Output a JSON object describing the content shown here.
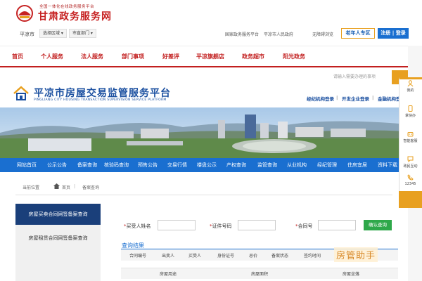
{
  "header": {
    "logo_subtitle": "全国一体化在线政务服务平台",
    "logo_title": "甘肃政务服务网",
    "city": "平凉市",
    "region_select": "选择区域",
    "dept_select": "市直部门",
    "links": [
      "国家政务服务平台",
      "平凉市人民政府",
      "无障碍浏览"
    ],
    "elder_button": "老年人专区",
    "login_button": "注册 | 登录"
  },
  "main_nav": [
    "首页",
    "个人服务",
    "法人服务",
    "部门事项",
    "好差评",
    "平凉旗舰店",
    "政务超市",
    "阳光政务"
  ],
  "subsite": {
    "search_placeholder": "请输入需要办理的事项",
    "title": "平凉市房屋交易监管服务平台",
    "title_en": "PINGLIANG CITY HOUSING TRANSACTION SUPERVISION SERVICE PLATFORM",
    "right_links": [
      "经纪机构登录",
      "开发企业登录",
      "金融机构登"
    ],
    "nav": [
      "网站首页",
      "公示公告",
      "备案查询",
      "核验码查询",
      "预售公告",
      "交易行情",
      "楼盘公示",
      "产权查询",
      "监管查询",
      "从业机构",
      "经纪管理",
      "住房宜居",
      "资料下载"
    ]
  },
  "breadcrumb": {
    "label": "当前位置",
    "home": "首页",
    "current": "备案查询"
  },
  "left_menu": [
    "房屋买卖合同网签备案查询",
    "房屋租赁合同网签备案查询"
  ],
  "form": {
    "fields": [
      {
        "label": "买受人姓名",
        "value": ""
      },
      {
        "label": "证件号码",
        "value": ""
      },
      {
        "label": "合同号",
        "value": ""
      }
    ],
    "query_button": "确认查询"
  },
  "results": {
    "title": "查询结果",
    "columns": [
      "合同编号",
      "出卖人",
      "买受人",
      "身份证号",
      "总价",
      "备案状态",
      "签约时间"
    ],
    "columns2": [
      "房屋用途",
      "房屋面积",
      "房屋坐落"
    ]
  },
  "watermark": "房管助手",
  "sidebar": {
    "items": [
      {
        "icon": "person-icon",
        "label": "我的"
      },
      {
        "icon": "phone-icon",
        "label": "掌快办"
      },
      {
        "icon": "robot-icon",
        "label": "智能客服"
      },
      {
        "icon": "chat-icon",
        "label": "政民互动"
      },
      {
        "icon": "hotline-icon",
        "label": "12345"
      }
    ]
  },
  "colors": {
    "brand_red": "#c21f1f",
    "nav_blue": "#1a6fd0",
    "accent_orange": "#e8a020",
    "query_green": "#2ea84a"
  }
}
